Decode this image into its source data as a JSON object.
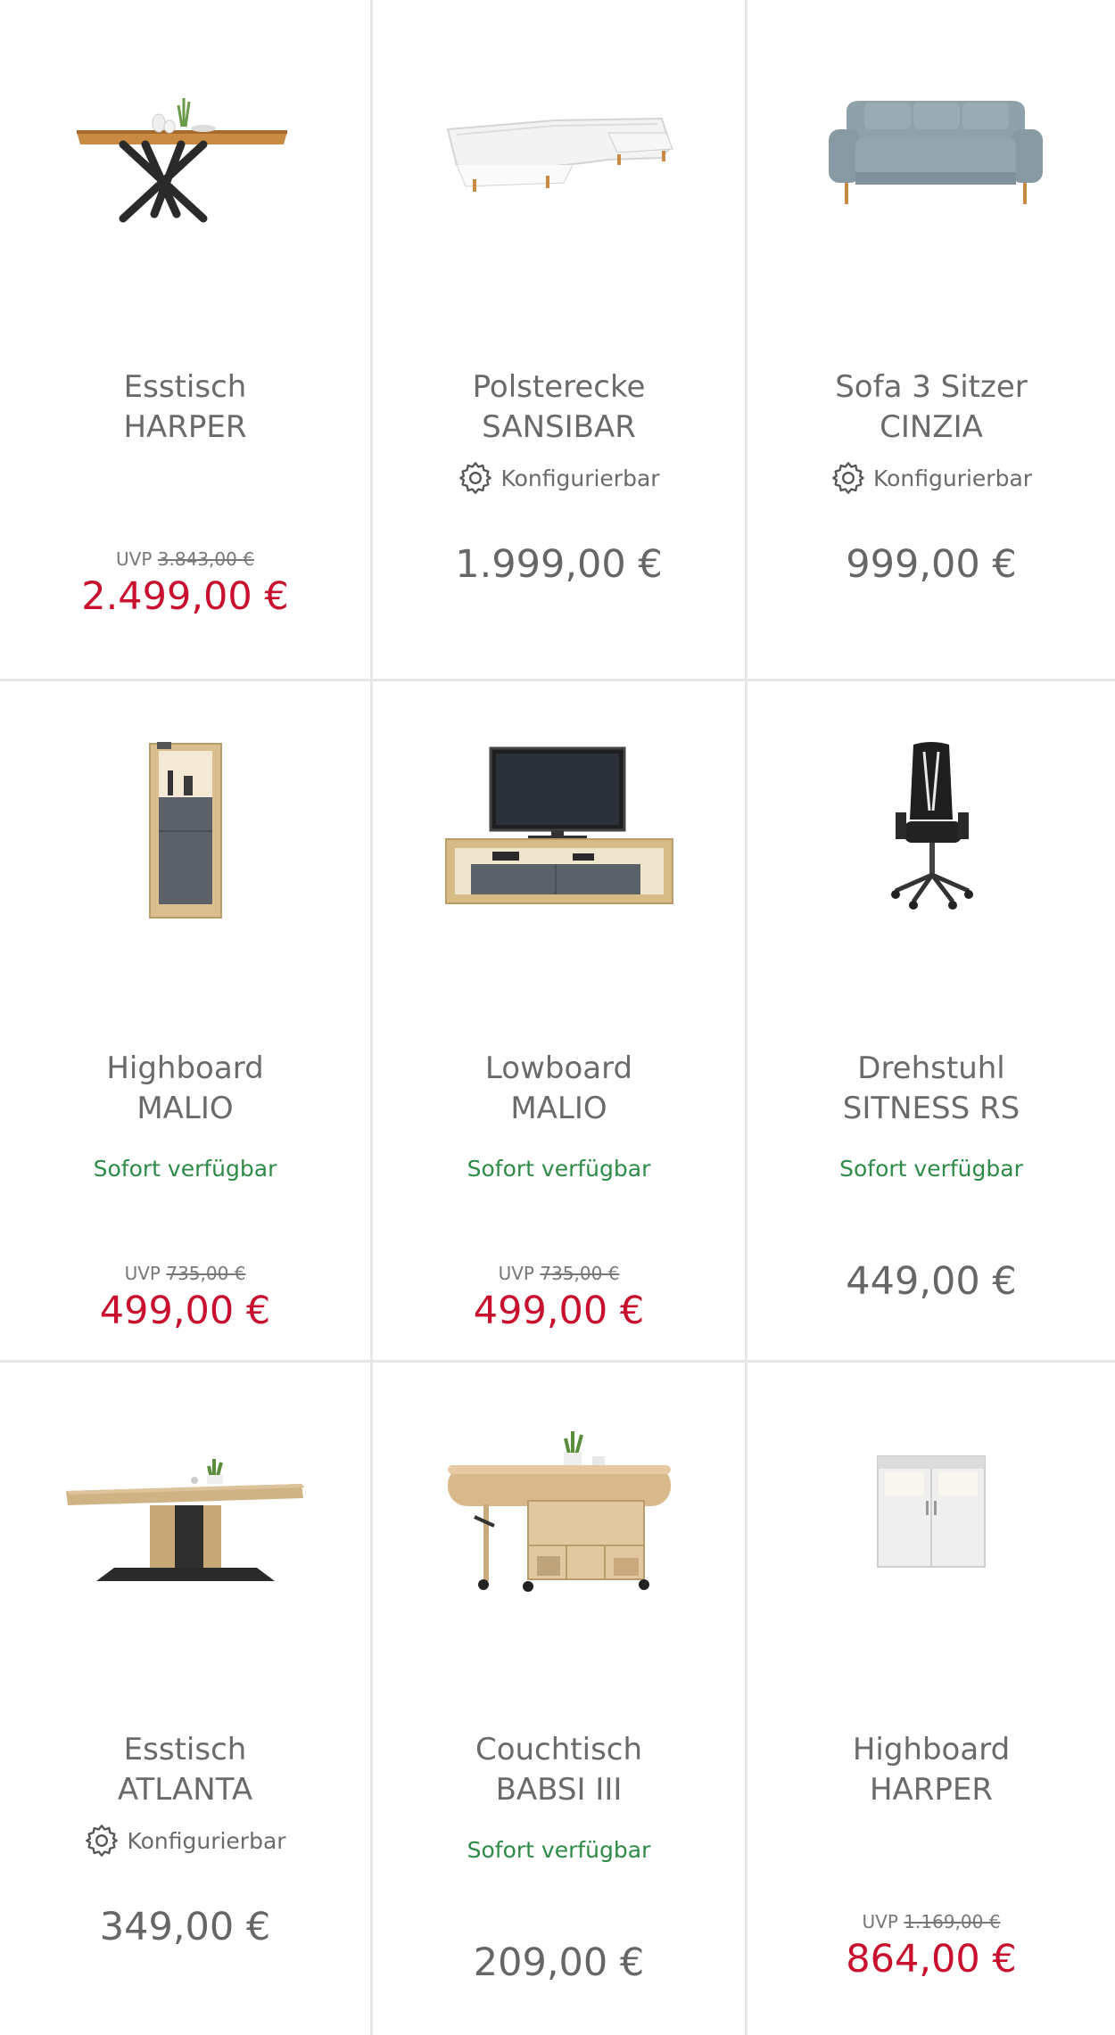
{
  "products": [
    {
      "line1": "Esstisch",
      "line2": "HARPER",
      "configurable": "",
      "availability": "",
      "uvp_label": "UVP",
      "uvp_price": "3.843,00 €",
      "price": "2.499,00 €",
      "sale": true,
      "image": "dining-table-x-legs"
    },
    {
      "line1": "Polsterecke",
      "line2": "SANSIBAR",
      "configurable": "Konfigurierbar",
      "availability": "",
      "uvp_label": "",
      "uvp_price": "",
      "price": "1.999,00 €",
      "sale": false,
      "image": "white-corner-sofa"
    },
    {
      "line1": "Sofa 3 Sitzer",
      "line2": "CINZIA",
      "configurable": "Konfigurierbar",
      "availability": "",
      "uvp_label": "",
      "uvp_price": "",
      "price": "999,00 €",
      "sale": false,
      "image": "grey-three-seat-sofa"
    },
    {
      "line1": "Highboard",
      "line2": "MALIO",
      "configurable": "",
      "availability": "Sofort verfügbar",
      "uvp_label": "UVP",
      "uvp_price": "735,00 €",
      "price": "499,00 €",
      "sale": true,
      "image": "highboard-cabinet"
    },
    {
      "line1": "Lowboard",
      "line2": "MALIO",
      "configurable": "",
      "availability": "Sofort verfügbar",
      "uvp_label": "UVP",
      "uvp_price": "735,00 €",
      "price": "499,00 €",
      "sale": true,
      "image": "tv-lowboard"
    },
    {
      "line1": "Drehstuhl",
      "line2": "SITNESS RS",
      "configurable": "",
      "availability": "Sofort verfügbar",
      "uvp_label": "",
      "uvp_price": "",
      "price": "449,00 €",
      "sale": false,
      "image": "gaming-office-chair"
    },
    {
      "line1": "Esstisch",
      "line2": "ATLANTA",
      "configurable": "Konfigurierbar",
      "availability": "",
      "uvp_label": "",
      "uvp_price": "",
      "price": "349,00 €",
      "sale": false,
      "image": "dining-table-pedestal"
    },
    {
      "line1": "Couchtisch",
      "line2": "BABSI III",
      "configurable": "",
      "availability": "Sofort verfügbar",
      "uvp_label": "",
      "uvp_price": "",
      "price": "209,00 €",
      "sale": false,
      "image": "coffee-table-shelves"
    },
    {
      "line1": "Highboard",
      "line2": "HARPER",
      "configurable": "",
      "availability": "",
      "uvp_label": "UVP",
      "uvp_price": "1.169,00 €",
      "price": "864,00 €",
      "sale": true,
      "image": "white-highboard"
    }
  ],
  "colors": {
    "sale": "#c8102e",
    "available": "#2e8b47",
    "text": "#666666",
    "border": "#e6e6e6"
  }
}
